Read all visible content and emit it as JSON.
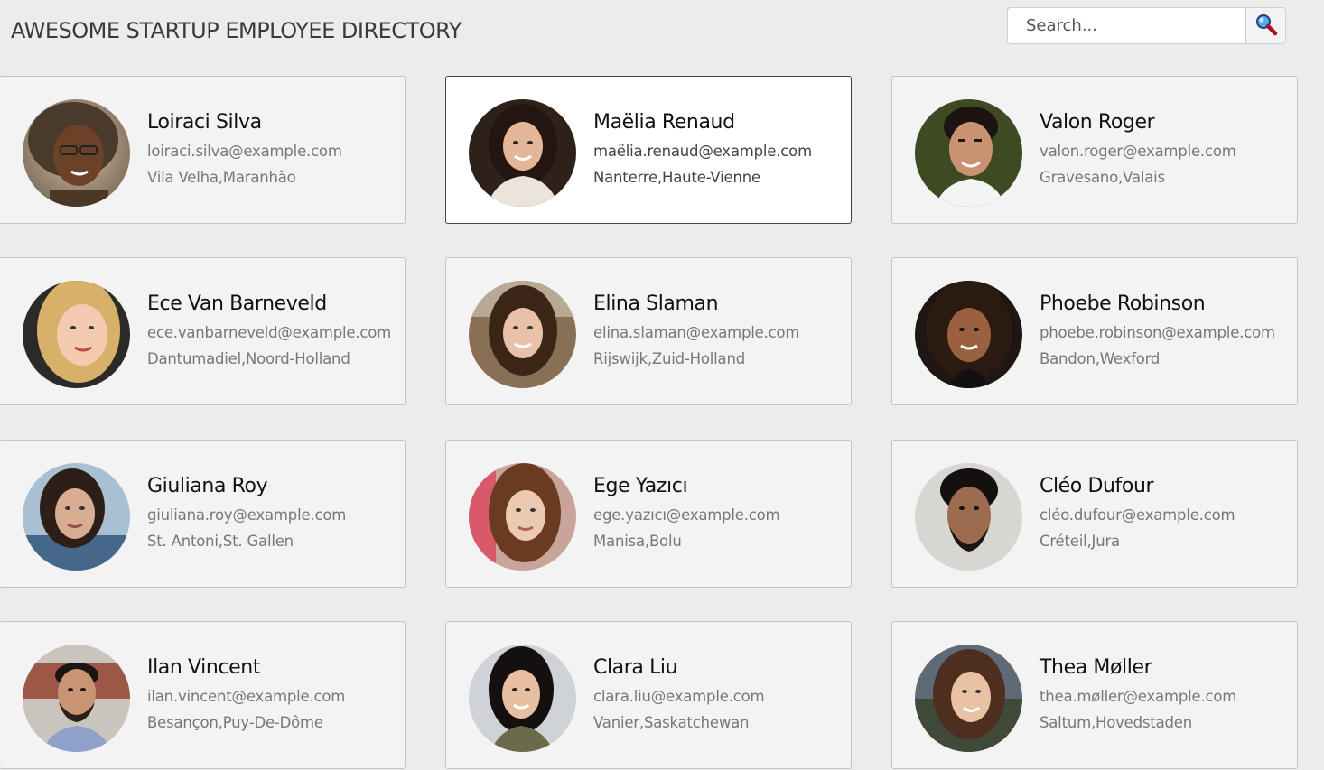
{
  "header": {
    "title": "AWESOME STARTUP EMPLOYEE DIRECTORY"
  },
  "search": {
    "placeholder": "Search...",
    "button_icon": "magnifier-icon"
  },
  "colors": {
    "background": "#ececec",
    "card_background": "#f3f3f3",
    "card_active_background": "#ffffff",
    "search_icon_lens": "#1f63c5",
    "search_icon_handle": "#a8141b"
  },
  "employees": [
    {
      "name": "Loiraci Silva",
      "email": "loiraci.silva@example.com",
      "location": "Vila Velha,Maranhão",
      "active": false
    },
    {
      "name": "Maëlia Renaud",
      "email": "maëlia.renaud@example.com",
      "location": "Nanterre,Haute-Vienne",
      "active": true
    },
    {
      "name": "Valon Roger",
      "email": "valon.roger@example.com",
      "location": "Gravesano,Valais",
      "active": false
    },
    {
      "name": "Ece Van Barneveld",
      "email": "ece.vanbarneveld@example.com",
      "location": "Dantumadiel,Noord-Holland",
      "active": false
    },
    {
      "name": "Elina Slaman",
      "email": "elina.slaman@example.com",
      "location": "Rijswijk,Zuid-Holland",
      "active": false
    },
    {
      "name": "Phoebe Robinson",
      "email": "phoebe.robinson@example.com",
      "location": "Bandon,Wexford",
      "active": false
    },
    {
      "name": "Giuliana Roy",
      "email": "giuliana.roy@example.com",
      "location": "St. Antoni,St. Gallen",
      "active": false
    },
    {
      "name": "Ege Yazıcı",
      "email": "ege.yazıcı@example.com",
      "location": "Manisa,Bolu",
      "active": false
    },
    {
      "name": "Cléo Dufour",
      "email": "cléo.dufour@example.com",
      "location": "Créteil,Jura",
      "active": false
    },
    {
      "name": "Ilan Vincent",
      "email": "ilan.vincent@example.com",
      "location": "Besançon,Puy-De-Dôme",
      "active": false
    },
    {
      "name": "Clara Liu",
      "email": "clara.liu@example.com",
      "location": "Vanier,Saskatchewan",
      "active": false
    },
    {
      "name": "Thea Møller",
      "email": "thea.møller@example.com",
      "location": "Saltum,Hovedstaden",
      "active": false
    }
  ]
}
